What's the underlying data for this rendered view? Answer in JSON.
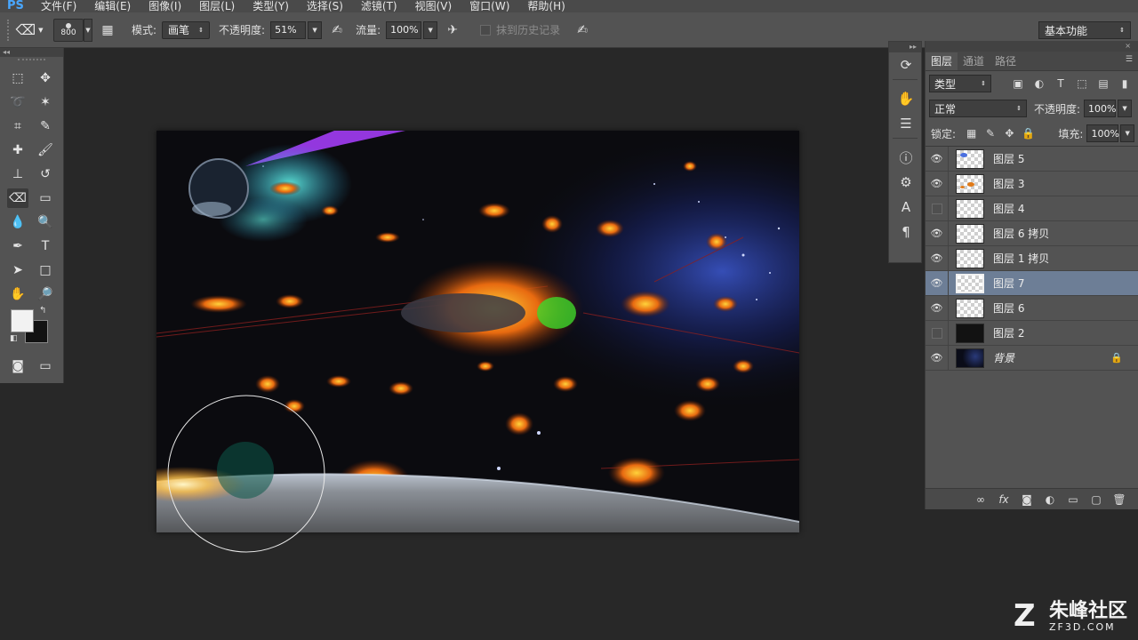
{
  "menubar": {
    "logo": "PS",
    "items": [
      "文件(F)",
      "编辑(E)",
      "图像(I)",
      "图层(L)",
      "类型(Y)",
      "选择(S)",
      "滤镜(T)",
      "视图(V)",
      "窗口(W)",
      "帮助(H)"
    ]
  },
  "options": {
    "brush_size": "800",
    "mode_label": "模式:",
    "mode_value": "画笔",
    "opacity_label": "不透明度:",
    "opacity_value": "51%",
    "flow_label": "流量:",
    "flow_value": "100%",
    "history_label": "抹到历史记录",
    "workspace": "基本功能"
  },
  "layers_panel": {
    "tabs": [
      "图层",
      "通道",
      "路径"
    ],
    "active_tab": 0,
    "filter_kind": "类型",
    "blend_mode": "正常",
    "opacity_label": "不透明度:",
    "opacity_value": "100%",
    "lock_label": "锁定:",
    "fill_label": "填充:",
    "fill_value": "100%",
    "layers": [
      {
        "name": "图层 5",
        "visible": true,
        "thumb": "transparent"
      },
      {
        "name": "图层 3",
        "visible": true,
        "thumb": "transparent"
      },
      {
        "name": "图层 4",
        "visible": false,
        "thumb": "transparent"
      },
      {
        "name": "图层 6 拷贝",
        "visible": true,
        "thumb": "transparent"
      },
      {
        "name": "图层 1 拷贝",
        "visible": true,
        "thumb": "transparent"
      },
      {
        "name": "图层 7",
        "visible": true,
        "thumb": "transparent",
        "selected": true
      },
      {
        "name": "图层 6",
        "visible": true,
        "thumb": "transparent"
      },
      {
        "name": "图层 2",
        "visible": false,
        "thumb": "dark"
      },
      {
        "name": "背景",
        "visible": true,
        "thumb": "space",
        "locked": true
      }
    ]
  },
  "watermark": {
    "logo_glyph": "Z",
    "brand_cn": "朱峰社区",
    "brand_en": "ZF3D.COM"
  },
  "colors": {
    "selected_layer": "#6d7e96",
    "panel_bg": "#535353",
    "workspace_bg": "#282828"
  }
}
